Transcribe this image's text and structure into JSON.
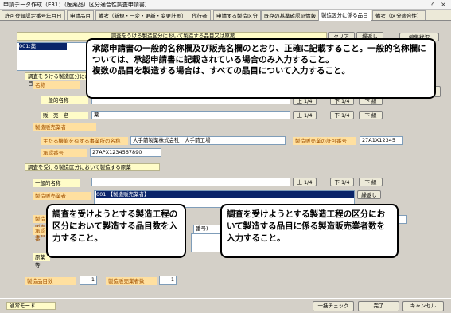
{
  "window": {
    "title": "申請データ作成（E31：（医薬品）区分適合性調査申請書）",
    "help": "?",
    "close": "×"
  },
  "tabs": [
    "許可登録認定番号年月日",
    "申請品目",
    "備考（新規・一変・更新・変更計画）",
    "代行者",
    "申請する製造区分",
    "既存の基準確認証情報",
    "製造区分に係る品目",
    "備考（区分適合性）"
  ],
  "active_tab": 6,
  "section1": {
    "title": "調査をうける製造区分において製造する品目又は原薬",
    "btn_clear": "クリア",
    "btn_repeat": "繰返し",
    "btn_edit": "編集状況",
    "list_item": "001:薬",
    "side_btn": "す"
  },
  "section2": {
    "title": "調査をうける製造区分において製造する品目",
    "name_label": "名称",
    "generic_label": "一般的名称",
    "brand_label": "販　売　名",
    "brand_value": "薬",
    "btn_up": "上 1/4",
    "btn_down": "下 1/4",
    "btn_bottom": "下 線",
    "maker_label": "製造販売業者",
    "office_label": "主たる機能を有する事業所の名称",
    "office_value": "大手前製薬株式会社　大手前工場",
    "license_label": "製造販売業の許可番号",
    "license_value": "27A1X12345",
    "approval_label": "承認番号",
    "approval_value": "27APX1234567890"
  },
  "section3": {
    "title": "調査を受ける製造区分において製造する原薬",
    "generic_label": "一般的名称",
    "maker_label": "製造販売業者",
    "maker_value": "001:【製造販売業者】",
    "btn_repeat": "繰返し",
    "hidden_item": "番号)",
    "approval_label": "承認番",
    "raw_label": "原薬等",
    "count_label": "製造品目数",
    "count_value": "1",
    "makers_count_label": "製造販売業者数",
    "makers_count_value": "1"
  },
  "callouts": {
    "top": "承認申請書の一般的名称欄及び販売名欄のとおり、正確に記載すること。一般的名称欄については、承認申請書に記載されている場合のみ入力すること。\n複数の品目を製造する場合は、すべての品目について入力すること。",
    "left": "調査を受けようとする製造工程の区分において製造する品目数を入力すること。",
    "right": "調査を受けようとする製造工程の区分において製造する品目に係る製造販売業者数を入力すること。"
  },
  "statusbar": {
    "mode": "通常モード",
    "btn_check": "一括チェック",
    "btn_done": "完了",
    "btn_cancel": "キャンセル"
  }
}
